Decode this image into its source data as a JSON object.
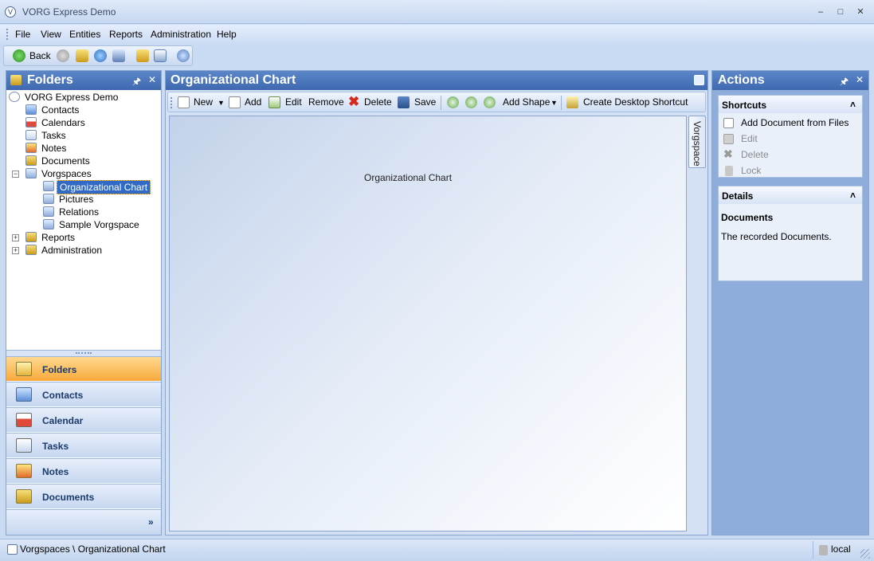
{
  "window": {
    "title": "VORG Express Demo"
  },
  "menu": [
    {
      "label": "File"
    },
    {
      "label": "View"
    },
    {
      "label": "Entities"
    },
    {
      "label": "Reports"
    },
    {
      "label": "Administration"
    },
    {
      "label": "Help"
    }
  ],
  "main_toolbar": {
    "back_label": "Back"
  },
  "folders_panel": {
    "title": "Folders",
    "tree": {
      "root": "VORG Express Demo",
      "items": [
        "Contacts",
        "Calendars",
        "Tasks",
        "Notes",
        "Documents",
        "Vorgspaces"
      ],
      "vorgspaces": [
        "Organizational Chart",
        "Pictures",
        "Relations",
        "Sample Vorgspace"
      ],
      "collapsed": [
        "Reports",
        "Administration"
      ]
    },
    "nav_buttons": [
      "Folders",
      "Contacts",
      "Calendar",
      "Tasks",
      "Notes",
      "Documents"
    ]
  },
  "center_panel": {
    "title": "Organizational Chart",
    "toolbar": {
      "new": "New",
      "add": "Add",
      "edit": "Edit",
      "remove": "Remove",
      "delete": "Delete",
      "save": "Save",
      "add_shape": "Add Shape",
      "create_shortcut": "Create Desktop Shortcut"
    },
    "canvas_label": "Organizational Chart",
    "side_tab": "Vorgspace"
  },
  "actions_panel": {
    "title": "Actions",
    "shortcuts": {
      "title": "Shortcuts",
      "items": [
        "Add Document from Files",
        "Edit",
        "Delete",
        "Lock"
      ]
    },
    "details": {
      "title": "Details",
      "heading": "Documents",
      "text": "The recorded Documents."
    }
  },
  "status": {
    "path": "Vorgspaces \\ Organizational Chart",
    "server": "local"
  },
  "colors": {
    "header": "#4a76bd",
    "accent": "#f7a93b",
    "selection": "#316ac5"
  }
}
